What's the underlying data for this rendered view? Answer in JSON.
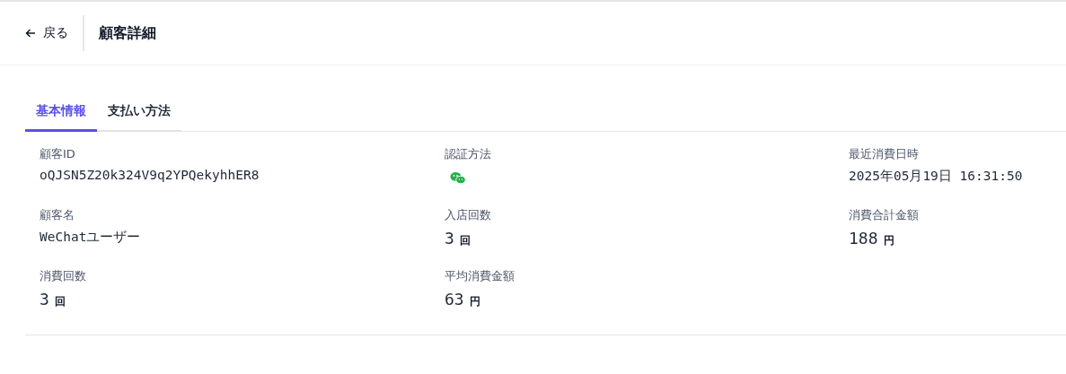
{
  "header": {
    "back": "戻る",
    "title": "顧客詳細"
  },
  "tabs": [
    {
      "label": "基本情報",
      "selected": true
    },
    {
      "label": "支払い方法",
      "selected": false
    }
  ],
  "fields": [
    {
      "label": "顧客ID",
      "kind": "text",
      "value": "oQJSN5Z20k324V9q2YPQekyhhER8"
    },
    {
      "label": "認証方法",
      "kind": "wechat"
    },
    {
      "label": "最近消費日時",
      "kind": "text",
      "value": "2025年05月19日 16:31:50"
    },
    {
      "label": "顧客名",
      "kind": "text",
      "value": "WeChatユーザー"
    },
    {
      "label": "入店回数",
      "kind": "amount",
      "value": "3",
      "unit": "回"
    },
    {
      "label": "消費合計金額",
      "kind": "amount",
      "value": "188",
      "unit": "円"
    },
    {
      "label": "消費回数",
      "kind": "amount",
      "value": "3",
      "unit": "回"
    },
    {
      "label": "平均消費金額",
      "kind": "amount",
      "value": "63",
      "unit": "円"
    }
  ]
}
